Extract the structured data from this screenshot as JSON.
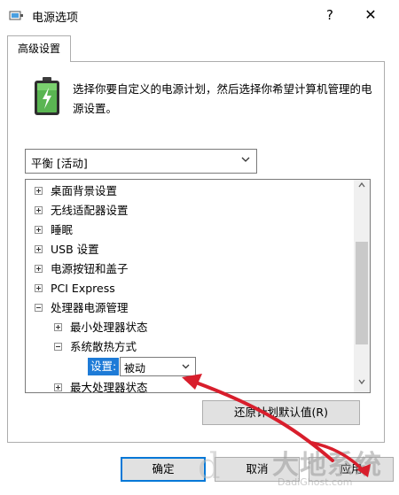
{
  "window": {
    "title": "电源选项",
    "help_label": "?",
    "close_label": "✕"
  },
  "tab": {
    "label": "高级设置"
  },
  "description": "选择你要自定义的电源计划，然后选择你希望计算机管理的电源设置。",
  "plan_select": {
    "value": "平衡 [活动]"
  },
  "tree": {
    "items": [
      {
        "label": "桌面背景设置",
        "expander": "+"
      },
      {
        "label": "无线适配器设置",
        "expander": "+"
      },
      {
        "label": "睡眠",
        "expander": "+"
      },
      {
        "label": "USB 设置",
        "expander": "+"
      },
      {
        "label": "电源按钮和盖子",
        "expander": "+"
      },
      {
        "label": "PCI Express",
        "expander": "+"
      },
      {
        "label": "处理器电源管理",
        "expander": "−"
      },
      {
        "label": "最小处理器状态",
        "expander": "+"
      },
      {
        "label": "系统散热方式",
        "expander": "−"
      },
      {
        "label": "最大处理器状态",
        "expander": "+"
      }
    ],
    "setting_label": "设置:",
    "setting_value": "被动"
  },
  "buttons": {
    "restore": "还原计划默认值(R)",
    "ok": "确定",
    "cancel": "取消",
    "apply": "应用"
  },
  "watermark": {
    "main": "大地系统",
    "sub": "DadiGhost.com",
    "letter": "d"
  },
  "colors": {
    "accent": "#0078d7",
    "selection": "#1e7bd7",
    "annotation_arrow": "#d81e2c"
  },
  "icons": {
    "window": "power-options-icon",
    "battery": "battery-icon"
  }
}
